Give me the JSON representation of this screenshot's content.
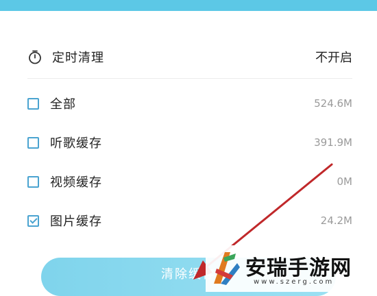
{
  "timer": {
    "icon": "timer-icon",
    "label": "定时清理",
    "value": "不开启"
  },
  "cache_items": [
    {
      "label": "全部",
      "size": "524.6M",
      "checked": false
    },
    {
      "label": "听歌缓存",
      "size": "391.9M",
      "checked": false
    },
    {
      "label": "视频缓存",
      "size": "0M",
      "checked": false
    },
    {
      "label": "图片缓存",
      "size": "24.2M",
      "checked": true
    }
  ],
  "clear_button": {
    "label": "清除缓存"
  },
  "watermark": {
    "title": "安瑞手游网",
    "url": "www.szerg.com"
  },
  "colors": {
    "banner": "#5cc8e6",
    "checkbox": "#4aa3d0",
    "button": "#8ad9ee",
    "arrow": "#c0282a"
  }
}
